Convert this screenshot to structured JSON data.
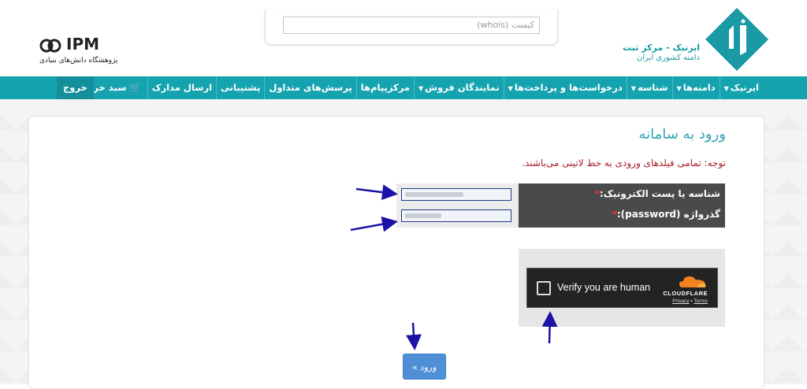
{
  "header": {
    "ipm_logo_text": "IPM",
    "ipm_subtitle": "پژوهشگاه دانش‌های بنیادی",
    "whois_placeholder": "کیست (whois)",
    "irnic_line1": "ایرنیک - مرکز ثبت",
    "irnic_line2": "دامنه کشوری ایران"
  },
  "nav": {
    "items": [
      {
        "label": "ایرنیک",
        "dropdown": true
      },
      {
        "label": "دامنه‌ها",
        "dropdown": true
      },
      {
        "label": "شناسه",
        "dropdown": true
      },
      {
        "label": "درخواست‌ها و پرداخت‌ها",
        "dropdown": true
      },
      {
        "label": "نمایندگان فروش",
        "dropdown": true
      },
      {
        "label": "مرکزپیام‌ها",
        "dropdown": false
      },
      {
        "label": "پرسش‌های متداول",
        "dropdown": false
      },
      {
        "label": "پشتیبانی",
        "dropdown": false
      },
      {
        "label": "ارسال مدارک",
        "dropdown": false
      }
    ],
    "cart_label": "سبد خرید",
    "exit_label": "خروج"
  },
  "login": {
    "title": "ورود به سامانه",
    "note": "توجه: تمامی فیلدهای ورودی به خط لاتینی می‌باشند.",
    "username_label": "شناسه یا پست الکترونیک:",
    "password_label": "گذرواژه (password):",
    "required_mark": "*",
    "submit_label": "ورود »"
  },
  "captcha": {
    "text": "Verify you are human",
    "brand": "CLOUDFLARE",
    "privacy": "Privacy",
    "separator": "•",
    "terms": "Terms"
  },
  "colors": {
    "nav": "#16a3b0",
    "title": "#2ea3b0",
    "note": "#a8202b",
    "button": "#4e8fd6",
    "arrow": "#1c12a8"
  }
}
